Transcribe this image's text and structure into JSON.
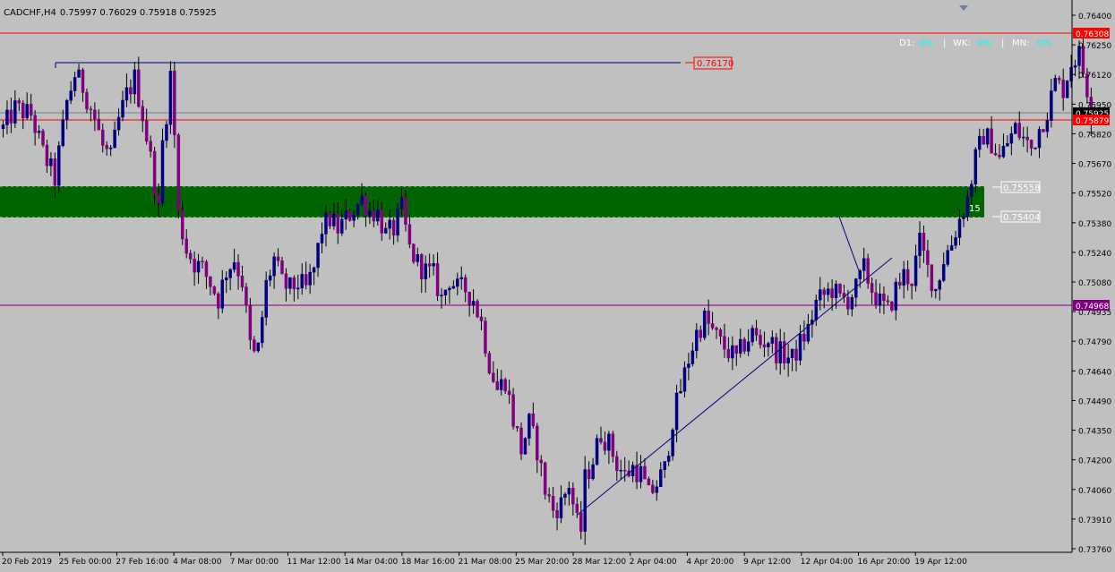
{
  "header": {
    "symbol_timeframe": "CADCHF,H4",
    "ohlc": "0.75997 0.76029 0.75918 0.75925"
  },
  "info_panel": {
    "d1_label": "D1:",
    "d1_value": "0%",
    "sep": "|",
    "wk_label": "WK:",
    "wk_value": "0%",
    "mn_label": "MN:",
    "mn_value": "0%"
  },
  "colors": {
    "background": "#c0c0c0",
    "bull_candle": "#000080",
    "bear_candle": "#800080",
    "wick": "#000000",
    "zone_fill": "#006400",
    "red_line": "#ff0000",
    "purple_line": "#800080",
    "trendline": "#000080",
    "bid_line": "#708090",
    "cyan_text": "#00ffff",
    "white_text": "#ffffff"
  },
  "chart_data": {
    "type": "candlestick",
    "symbol": "CADCHF",
    "timeframe": "H4",
    "ylim": [
      0.7376,
      0.7642
    ],
    "y_ticks": [
      "0.76400",
      "0.76250",
      "0.76120",
      "0.75950",
      "0.75820",
      "0.75670",
      "0.75520",
      "0.75380",
      "0.75240",
      "0.75080",
      "0.74935",
      "0.74790",
      "0.74640",
      "0.74490",
      "0.74350",
      "0.74200",
      "0.74060",
      "0.73910",
      "0.73760"
    ],
    "x_ticks": [
      "20 Feb 2019",
      "25 Feb 00:00",
      "27 Feb 16:00",
      "4 Mar 08:00",
      "7 Mar 00:00",
      "11 Mar 12:00",
      "14 Mar 04:00",
      "18 Mar 16:00",
      "21 Mar 08:00",
      "25 Mar 20:00",
      "28 Mar 12:00",
      "2 Apr 04:00",
      "4 Apr 20:00",
      "9 Apr 12:00",
      "12 Apr 04:00",
      "16 Apr 20:00",
      "19 Apr 12:00"
    ],
    "price_labels": {
      "red_top": "0.76308",
      "current": "0.75925",
      "red_mid": "0.75879",
      "purple": "0.74968",
      "blue_level": "0.76170",
      "zone_top": "0.75558",
      "zone_bottom": "0.75404"
    },
    "zone_label": "15",
    "path": [
      [
        0,
        0.7585
      ],
      [
        3,
        0.7595
      ],
      [
        7,
        0.7592
      ],
      [
        10,
        0.7573
      ],
      [
        13,
        0.756
      ],
      [
        16,
        0.7598
      ],
      [
        18,
        0.7612
      ],
      [
        20,
        0.7606
      ],
      [
        23,
        0.759
      ],
      [
        25,
        0.7576
      ],
      [
        27,
        0.757
      ],
      [
        29,
        0.7589
      ],
      [
        31,
        0.7602
      ],
      [
        33,
        0.761
      ],
      [
        35,
        0.7592
      ],
      [
        37,
        0.757
      ],
      [
        38,
        0.7558
      ],
      [
        39,
        0.7544
      ],
      [
        40,
        0.7578
      ],
      [
        41,
        0.7593
      ],
      [
        42,
        0.7612
      ],
      [
        43,
        0.7582
      ],
      [
        44,
        0.7542
      ],
      [
        46,
        0.7525
      ],
      [
        48,
        0.7518
      ],
      [
        50,
        0.7515
      ],
      [
        52,
        0.7508
      ],
      [
        54,
        0.75
      ],
      [
        56,
        0.7514
      ],
      [
        58,
        0.752
      ],
      [
        60,
        0.7509
      ],
      [
        62,
        0.7477
      ],
      [
        63,
        0.7472
      ],
      [
        64,
        0.7475
      ],
      [
        66,
        0.7507
      ],
      [
        68,
        0.752
      ],
      [
        70,
        0.7508
      ],
      [
        72,
        0.7505
      ],
      [
        74,
        0.7508
      ],
      [
        76,
        0.7505
      ],
      [
        78,
        0.7515
      ],
      [
        80,
        0.7535
      ],
      [
        82,
        0.754
      ],
      [
        84,
        0.7535
      ],
      [
        86,
        0.754
      ],
      [
        88,
        0.7545
      ],
      [
        90,
        0.755
      ],
      [
        92,
        0.7544
      ],
      [
        94,
        0.7543
      ],
      [
        96,
        0.7532
      ],
      [
        98,
        0.7535
      ],
      [
        100,
        0.7545
      ],
      [
        102,
        0.7525
      ],
      [
        104,
        0.7518
      ],
      [
        106,
        0.7514
      ],
      [
        108,
        0.7512
      ],
      [
        110,
        0.75
      ],
      [
        112,
        0.751
      ],
      [
        114,
        0.7505
      ],
      [
        116,
        0.7505
      ],
      [
        118,
        0.75
      ],
      [
        120,
        0.7488
      ],
      [
        122,
        0.7468
      ],
      [
        124,
        0.7455
      ],
      [
        126,
        0.746
      ],
      [
        128,
        0.744
      ],
      [
        130,
        0.7425
      ],
      [
        132,
        0.7438
      ],
      [
        134,
        0.7425
      ],
      [
        136,
        0.7405
      ],
      [
        138,
        0.7395
      ],
      [
        140,
        0.7398
      ],
      [
        142,
        0.7408
      ],
      [
        144,
        0.7388
      ],
      [
        145,
        0.7385
      ],
      [
        146,
        0.741
      ],
      [
        148,
        0.742
      ],
      [
        150,
        0.7433
      ],
      [
        152,
        0.7428
      ],
      [
        154,
        0.7418
      ],
      [
        156,
        0.7412
      ],
      [
        158,
        0.7416
      ],
      [
        160,
        0.7413
      ],
      [
        162,
        0.7402
      ],
      [
        164,
        0.7408
      ],
      [
        166,
        0.7415
      ],
      [
        168,
        0.744
      ],
      [
        170,
        0.7455
      ],
      [
        172,
        0.747
      ],
      [
        174,
        0.7483
      ],
      [
        176,
        0.749
      ],
      [
        178,
        0.7484
      ],
      [
        180,
        0.7478
      ],
      [
        182,
        0.7474
      ],
      [
        184,
        0.747
      ],
      [
        186,
        0.7478
      ],
      [
        188,
        0.7483
      ],
      [
        190,
        0.7478
      ],
      [
        192,
        0.748
      ],
      [
        194,
        0.7474
      ],
      [
        196,
        0.7472
      ],
      [
        198,
        0.747
      ],
      [
        200,
        0.7478
      ],
      [
        202,
        0.7485
      ],
      [
        204,
        0.7498
      ],
      [
        206,
        0.7502
      ],
      [
        208,
        0.7505
      ],
      [
        210,
        0.75
      ],
      [
        212,
        0.75
      ],
      [
        214,
        0.7505
      ],
      [
        216,
        0.7515
      ],
      [
        218,
        0.7505
      ],
      [
        220,
        0.7498
      ],
      [
        222,
        0.7494
      ],
      [
        224,
        0.7505
      ],
      [
        226,
        0.7512
      ],
      [
        228,
        0.751
      ],
      [
        230,
        0.7528
      ],
      [
        232,
        0.7515
      ],
      [
        234,
        0.7505
      ],
      [
        236,
        0.752
      ],
      [
        238,
        0.7528
      ],
      [
        240,
        0.754
      ],
      [
        242,
        0.755
      ],
      [
        244,
        0.757
      ],
      [
        246,
        0.7582
      ],
      [
        248,
        0.7578
      ],
      [
        250,
        0.757
      ],
      [
        252,
        0.7578
      ],
      [
        254,
        0.7585
      ],
      [
        256,
        0.758
      ],
      [
        258,
        0.7575
      ],
      [
        260,
        0.7585
      ],
      [
        262,
        0.7594
      ],
      [
        264,
        0.7608
      ],
      [
        266,
        0.7605
      ],
      [
        268,
        0.7618
      ],
      [
        270,
        0.7622
      ],
      [
        272,
        0.7605
      ],
      [
        273,
        0.7593
      ]
    ]
  }
}
